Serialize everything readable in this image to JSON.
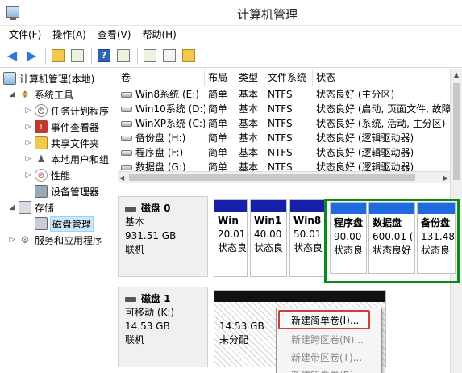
{
  "window": {
    "title": "计算机管理"
  },
  "menu": [
    "文件(F)",
    "操作(A)",
    "查看(V)",
    "帮助(H)"
  ],
  "tree": {
    "root": "计算机管理(本地)",
    "system_tools": "系统工具",
    "task_scheduler": "任务计划程序",
    "event_viewer": "事件查看器",
    "shared_folders": "共享文件夹",
    "local_users": "本地用户和组",
    "performance": "性能",
    "device_manager": "设备管理器",
    "storage": "存储",
    "disk_management": "磁盘管理",
    "services_apps": "服务和应用程序"
  },
  "volumes": {
    "headers": {
      "volume": "卷",
      "layout": "布局",
      "type": "类型",
      "fs": "文件系统",
      "status": "状态"
    },
    "rows": [
      {
        "volume": "Win8系统 (E:)",
        "layout": "简单",
        "type": "基本",
        "fs": "NTFS",
        "status": "状态良好 (主分区)"
      },
      {
        "volume": "Win10系统 (D:)",
        "layout": "简单",
        "type": "基本",
        "fs": "NTFS",
        "status": "状态良好 (启动, 页面文件, 故障"
      },
      {
        "volume": "WinXP系统 (C:)",
        "layout": "简单",
        "type": "基本",
        "fs": "NTFS",
        "status": "状态良好 (系统, 活动, 主分区)"
      },
      {
        "volume": "备份盘 (H:)",
        "layout": "简单",
        "type": "基本",
        "fs": "NTFS",
        "status": "状态良好 (逻辑驱动器)"
      },
      {
        "volume": "程序盘 (F:)",
        "layout": "简单",
        "type": "基本",
        "fs": "NTFS",
        "status": "状态良好 (逻辑驱动器)"
      },
      {
        "volume": "数据盘 (G:)",
        "layout": "简单",
        "type": "基本",
        "fs": "NTFS",
        "status": "状态良好 (逻辑驱动器)"
      }
    ]
  },
  "disk0": {
    "name": "磁盘 0",
    "type": "基本",
    "size": "931.51 GB",
    "state": "联机",
    "partitions": [
      {
        "name": "Win",
        "size": "20.01",
        "status": "状态良"
      },
      {
        "name": "Win1",
        "size": "40.00",
        "status": "状态良"
      },
      {
        "name": "Win8",
        "size": "50.01",
        "status": "状态良"
      },
      {
        "name": "程序盘",
        "size": "90.00",
        "status": "状态良"
      },
      {
        "name": "数据盘",
        "size": "600.01 (",
        "status": "状态良好"
      },
      {
        "name": "备份盘",
        "size": "131.48",
        "status": "状态良"
      }
    ]
  },
  "disk1": {
    "name": "磁盘 1",
    "type": "可移动 (K:)",
    "size": "14.53 GB",
    "state": "联机",
    "unalloc_size": "14.53 GB",
    "unalloc_label": "未分配"
  },
  "context_menu": {
    "items": [
      "新建简单卷(I)...",
      "新建跨区卷(N)...",
      "新建带区卷(T)...",
      "新建镜像卷(R)..."
    ]
  }
}
